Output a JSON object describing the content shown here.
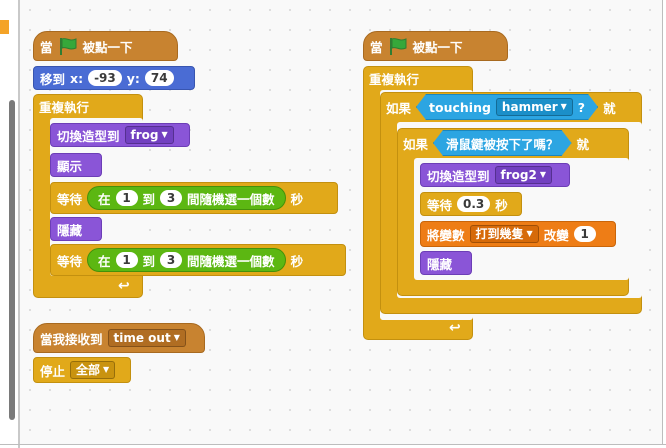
{
  "script1": {
    "hat": {
      "label_before": "當",
      "label_after": "被點一下"
    },
    "goto": {
      "label": "移到",
      "x_label": "x:",
      "x_value": "-93",
      "y_label": "y:",
      "y_value": "74"
    },
    "forever": {
      "label": "重複執行"
    },
    "switch_costume": {
      "label": "切換造型到",
      "costume": "frog"
    },
    "show": {
      "label": "顯示"
    },
    "wait1": {
      "label": "等待",
      "in_label": "在",
      "from": "1",
      "to_label": "到",
      "to": "3",
      "random_label": "間隨機選一個數",
      "unit": "秒"
    },
    "hide": {
      "label": "隱藏"
    },
    "wait2": {
      "label": "等待",
      "in_label": "在",
      "from": "1",
      "to_label": "到",
      "to": "3",
      "random_label": "間隨機選一個數",
      "unit": "秒"
    }
  },
  "script2": {
    "hat": {
      "label": "當我接收到",
      "message": "time out"
    },
    "stop": {
      "label": "停止",
      "option": "全部"
    }
  },
  "script3": {
    "hat": {
      "label_before": "當",
      "label_after": "被點一下"
    },
    "forever": {
      "label": "重複執行"
    },
    "if1": {
      "label": "如果",
      "touching_label": "touching",
      "target": "hammer",
      "question": "?",
      "then": "就"
    },
    "if2": {
      "label": "如果",
      "condition": "滑鼠鍵被按下了嗎？",
      "then": "就"
    },
    "switch_costume": {
      "label": "切換造型到",
      "costume": "frog2"
    },
    "wait": {
      "label": "等待",
      "value": "0.3",
      "unit": "秒"
    },
    "set_var": {
      "label": "將變數",
      "variable": "打到幾隻",
      "change_label": "改變",
      "value": "1"
    },
    "hide": {
      "label": "隱藏"
    }
  },
  "colors": {
    "events": "#c88330",
    "control": "#e1a91a",
    "motion": "#4a6cd4",
    "looks": "#8a55d7",
    "sensing": "#2ca5e2",
    "operators": "#5cb712",
    "data": "#ee7d16",
    "flag": "#36a83a"
  }
}
